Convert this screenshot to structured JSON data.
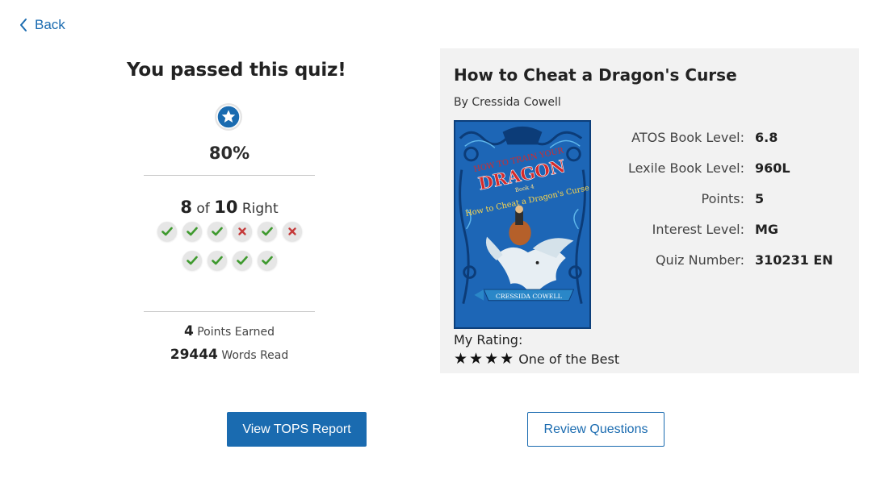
{
  "nav": {
    "back_label": "Back"
  },
  "result": {
    "heading": "You passed this quiz!",
    "percent": "80%",
    "correct": "8",
    "of": "of",
    "total": "10",
    "right": "Right",
    "answers_row1": [
      "correct",
      "correct",
      "correct",
      "incorrect",
      "correct",
      "incorrect"
    ],
    "answers_row2": [
      "correct",
      "correct",
      "correct",
      "correct"
    ],
    "points_earned_value": "4",
    "points_earned_label": "Points Earned",
    "words_read_value": "29444",
    "words_read_label": "Words Read"
  },
  "book": {
    "title": "How to Cheat a Dragon's Curse",
    "author": "By Cressida Cowell",
    "cover_lettering": [
      "HOW TO TRAIN YOUR",
      "DRAGON",
      "Book 4",
      "How to Cheat a Dragon's Curse",
      "CRESSIDA COWELL"
    ],
    "stats": [
      {
        "label": "ATOS Book Level:",
        "value": "6.8"
      },
      {
        "label": "Lexile Book Level:",
        "value": "960L"
      },
      {
        "label": "Points:",
        "value": "5"
      },
      {
        "label": "Interest Level:",
        "value": "MG"
      },
      {
        "label": "Quiz Number:",
        "value": "310231 EN"
      }
    ],
    "rating_label": "My Rating:",
    "rating_stars": 4,
    "rating_text": "One of the Best"
  },
  "actions": {
    "tops_label": "View TOPS Report",
    "review_label": "Review Questions"
  },
  "colors": {
    "accent": "#1a6bb0",
    "correct": "#3f9a2f",
    "incorrect": "#c53a3a",
    "panel": "#f2f2f2"
  },
  "icons": {
    "back": "chevron-left-icon",
    "badge": "star-badge-icon",
    "correct": "checkmark-icon",
    "incorrect": "x-mark-icon",
    "rating": "star-icon"
  }
}
